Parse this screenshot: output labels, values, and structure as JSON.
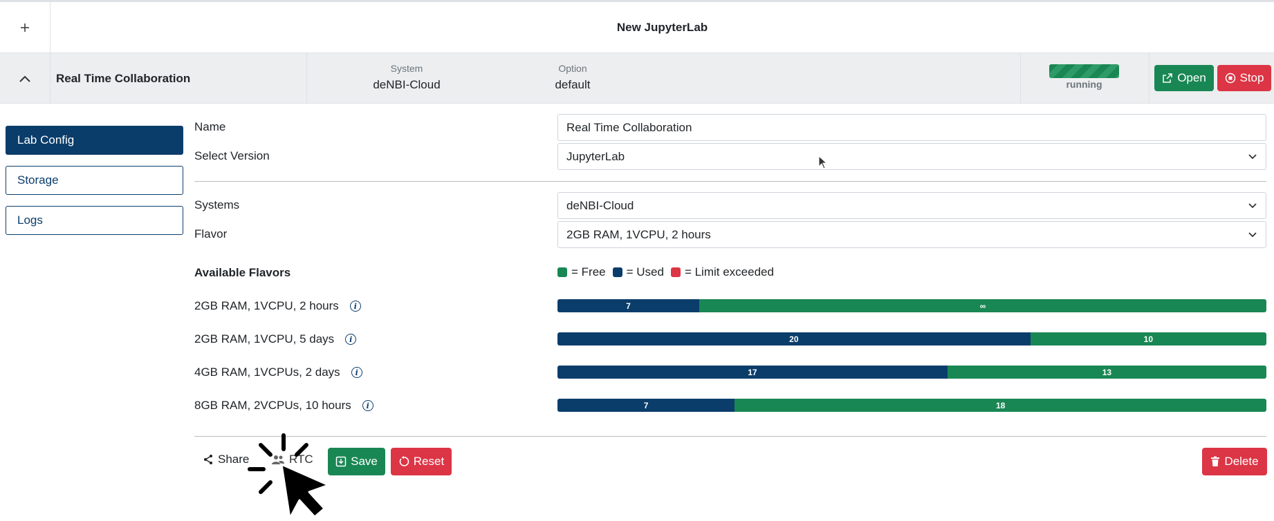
{
  "header": {
    "add_icon": "plus-icon",
    "title": "New JupyterLab"
  },
  "lab": {
    "name": "Real Time Collaboration",
    "system_label": "System",
    "system_value": "deNBI-Cloud",
    "option_label": "Option",
    "option_value": "default",
    "status": "running",
    "open_label": "Open",
    "stop_label": "Stop"
  },
  "sidebar": {
    "items": [
      {
        "label": "Lab Config",
        "active": true
      },
      {
        "label": "Storage",
        "active": false
      },
      {
        "label": "Logs",
        "active": false
      }
    ]
  },
  "form": {
    "name_label": "Name",
    "name_value": "Real Time Collaboration",
    "version_label": "Select Version",
    "version_value": "JupyterLab",
    "systems_label": "Systems",
    "systems_value": "deNBI-Cloud",
    "flavor_label": "Flavor",
    "flavor_value": "2GB RAM, 1VCPU, 2 hours"
  },
  "flavors": {
    "heading": "Available Flavors",
    "legend": {
      "free": "= Free",
      "used": "= Used",
      "limit": "= Limit exceeded"
    },
    "colors": {
      "free": "#198754",
      "used": "#0b3d6b",
      "limit": "#dc3545"
    },
    "items": [
      {
        "label": "2GB RAM, 1VCPU, 2 hours",
        "used": "7",
        "free": "∞",
        "used_fraction": 0.2
      },
      {
        "label": "2GB RAM, 1VCPU, 5 days",
        "used": "20",
        "free": "10",
        "used_fraction": 0.667
      },
      {
        "label": "4GB RAM, 1VCPUs, 2 days",
        "used": "17",
        "free": "13",
        "used_fraction": 0.55
      },
      {
        "label": "8GB RAM, 2VCPUs, 10 hours",
        "used": "7",
        "free": "18",
        "used_fraction": 0.25
      }
    ]
  },
  "actions": {
    "share_label": "Share",
    "rtc_label": "RTC",
    "save_label": "Save",
    "reset_label": "Reset",
    "delete_label": "Delete"
  }
}
